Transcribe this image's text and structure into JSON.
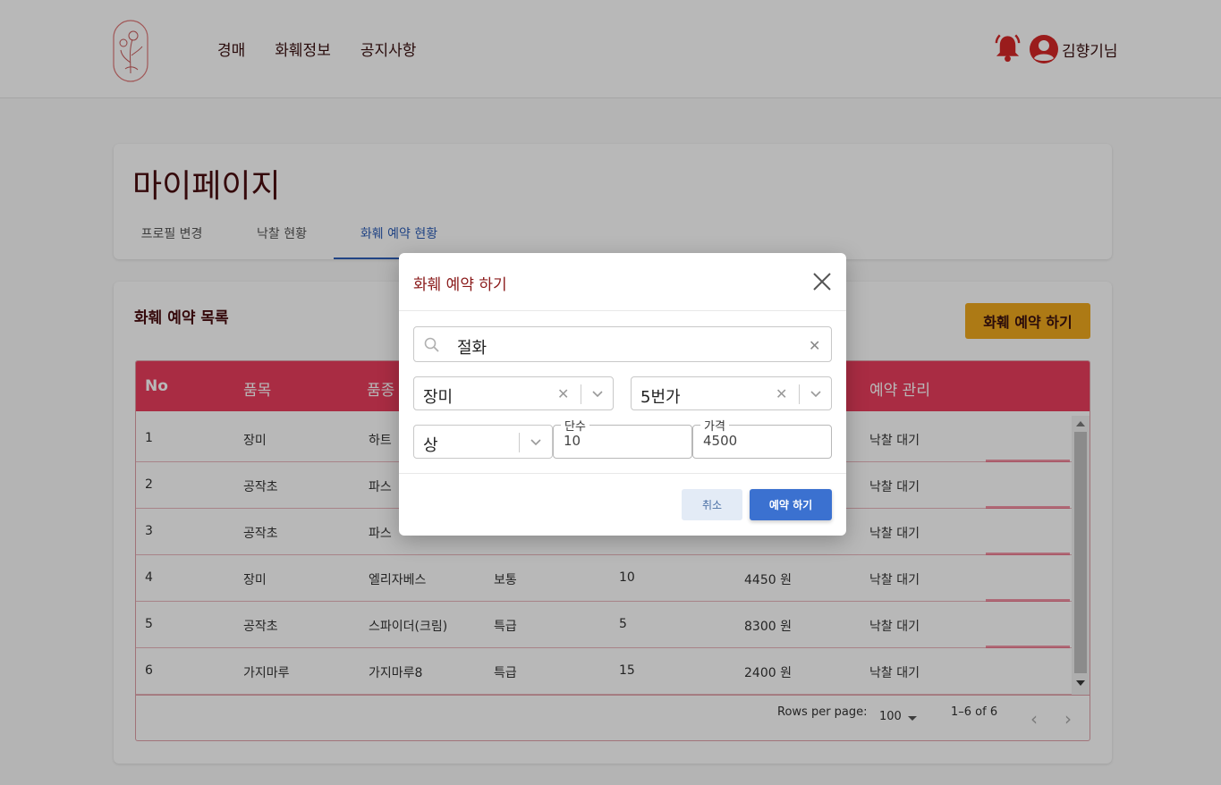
{
  "header": {
    "nav": [
      "경매",
      "화훼정보",
      "공지사항"
    ],
    "user_name": "김향기님"
  },
  "mypage": {
    "title": "마이페이지",
    "tabs": [
      "프로필 변경",
      "낙찰 현황",
      "화훼 예약 현황"
    ],
    "active_tab": 2
  },
  "list": {
    "title": "화훼 예약 목록",
    "reserve_button": "화훼 예약 하기",
    "columns": [
      "No",
      "품목",
      "품종",
      "",
      "",
      "",
      "예약 관리"
    ],
    "rows": [
      {
        "no": "1",
        "item": "장미",
        "variety": "하트",
        "grade": "",
        "qty": "",
        "price": "",
        "status": "낙찰 대기"
      },
      {
        "no": "2",
        "item": "공작초",
        "variety": "파스",
        "grade": "",
        "qty": "",
        "price": "",
        "status": "낙찰 대기"
      },
      {
        "no": "3",
        "item": "공작초",
        "variety": "파스",
        "grade": "",
        "qty": "",
        "price": "",
        "status": "낙찰 대기"
      },
      {
        "no": "4",
        "item": "장미",
        "variety": "엘리자베스",
        "grade": "보통",
        "qty": "10",
        "price": "4450 원",
        "status": "낙찰 대기"
      },
      {
        "no": "5",
        "item": "공작초",
        "variety": "스파이더(크림)",
        "grade": "특급",
        "qty": "5",
        "price": "8300 원",
        "status": "낙찰 대기"
      },
      {
        "no": "6",
        "item": "가지마루",
        "variety": "가지마루8",
        "grade": "특급",
        "qty": "15",
        "price": "2400 원",
        "status": "낙찰 대기"
      }
    ],
    "footer": {
      "rows_per_page_label": "Rows per page:",
      "rows_per_page_value": "100",
      "range": "1–6 of 6"
    }
  },
  "modal": {
    "title": "화훼 예약 하기",
    "search_value": "절화",
    "select_item": "장미",
    "select_variety": "5번가",
    "select_grade": "상",
    "qty_label": "단수",
    "qty_value": "10",
    "price_label": "가격",
    "price_value": "4500",
    "cancel_label": "취소",
    "submit_label": "예약 하기"
  },
  "colors": {
    "table_header": "#ea3e5e",
    "reserve_button": "#f0a91e",
    "primary": "#3b71d0",
    "active_tab": "#2f5fb8"
  },
  "icons": [
    "logo-flower-icon",
    "bell-icon",
    "user-avatar-icon",
    "close-icon",
    "search-icon",
    "clear-icon",
    "chevron-down-icon",
    "chevron-left-icon",
    "chevron-right-icon"
  ]
}
